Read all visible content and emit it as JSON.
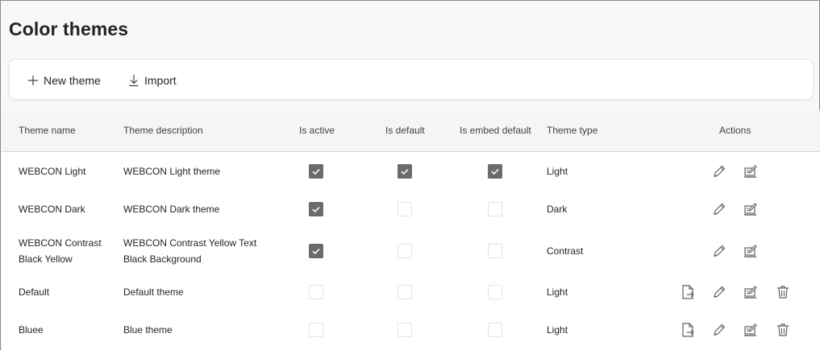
{
  "page": {
    "title": "Color themes"
  },
  "toolbar": {
    "new_label": "New theme",
    "import_label": "Import"
  },
  "table": {
    "columns": {
      "name": "Theme name",
      "description": "Theme description",
      "is_active": "Is active",
      "is_default": "Is default",
      "is_embed_default": "Is embed default",
      "type": "Theme type",
      "actions": "Actions"
    },
    "rows": [
      {
        "name": [
          "WEBCON Light"
        ],
        "description": [
          "WEBCON Light theme"
        ],
        "is_active": true,
        "is_default": true,
        "is_embed_default": true,
        "type": "Light",
        "actions": [
          "edit",
          "edit-as-new"
        ]
      },
      {
        "name": [
          "WEBCON Dark"
        ],
        "description": [
          "WEBCON Dark theme"
        ],
        "is_active": true,
        "is_default": false,
        "is_embed_default": false,
        "type": "Dark",
        "actions": [
          "edit",
          "edit-as-new"
        ]
      },
      {
        "name": [
          "WEBCON Contrast",
          "Black Yellow"
        ],
        "description": [
          "WEBCON Contrast Yellow Text",
          "Black Background"
        ],
        "is_active": true,
        "is_default": false,
        "is_embed_default": false,
        "type": "Contrast",
        "actions": [
          "edit",
          "edit-as-new"
        ]
      },
      {
        "name": [
          "Default"
        ],
        "description": [
          "Default theme"
        ],
        "is_active": false,
        "is_default": false,
        "is_embed_default": false,
        "type": "Light",
        "actions": [
          "export",
          "edit",
          "edit-as-new",
          "delete"
        ]
      },
      {
        "name": [
          "Bluee"
        ],
        "description": [
          "Blue theme"
        ],
        "is_active": false,
        "is_default": false,
        "is_embed_default": false,
        "type": "Light",
        "actions": [
          "export",
          "edit",
          "edit-as-new",
          "delete"
        ]
      }
    ]
  },
  "icons": {
    "new": "plus-icon",
    "import": "download-icon",
    "export": "document-export-icon",
    "edit": "pencil-icon",
    "edit_as_new": "edit-window-icon",
    "delete": "trash-icon"
  },
  "colors": {
    "checked": "#6b6b6b",
    "text": "#242424",
    "header_bg": "#f5f5f5",
    "page_bg": "#f8f8f8"
  }
}
